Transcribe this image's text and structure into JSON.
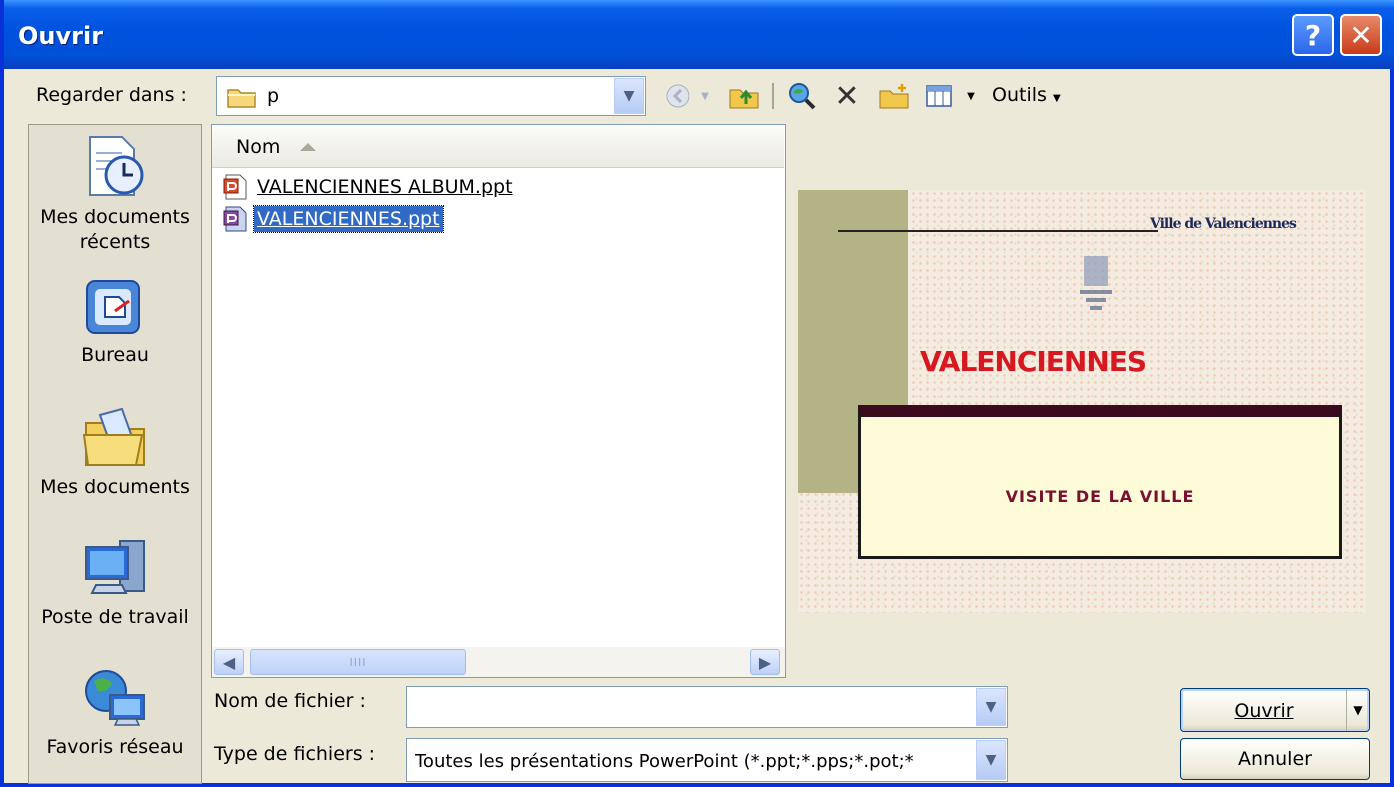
{
  "window": {
    "title": "Ouvrir"
  },
  "titlebar": {
    "help_glyph": "?",
    "close_glyph": "✕"
  },
  "lookin": {
    "label": "Regarder dans :",
    "value": "p"
  },
  "toolbar": {
    "tools_label": "Outils",
    "icons": [
      "back-icon",
      "up-folder-icon",
      "search-web-icon",
      "delete-icon",
      "new-folder-icon",
      "views-icon"
    ]
  },
  "places": [
    {
      "label": "Mes documents récents",
      "icon": "recent-documents-icon"
    },
    {
      "label": "Bureau",
      "icon": "desktop-icon"
    },
    {
      "label": "Mes documents",
      "icon": "my-documents-icon"
    },
    {
      "label": "Poste de travail",
      "icon": "my-computer-icon"
    },
    {
      "label": "Favoris réseau",
      "icon": "network-places-icon"
    }
  ],
  "filelist": {
    "column_header": "Nom",
    "files": [
      {
        "name": "VALENCIENNES ALBUM.ppt",
        "selected": false
      },
      {
        "name": "VALENCIENNES.ppt",
        "selected": true
      }
    ],
    "scroll_thumb_grip": "IIII"
  },
  "preview": {
    "logo_text": "Ville de Valenciennes",
    "title": "VALENCIENNES",
    "subtitle": "VISITE DE LA VILLE"
  },
  "form": {
    "filename_label": "Nom de fichier :",
    "filename_value": "",
    "filetype_label": "Type de fichiers :",
    "filetype_value": "Toutes les présentations PowerPoint (*.ppt;*.pps;*.pot;*"
  },
  "buttons": {
    "open": "Ouvrir",
    "cancel": "Annuler"
  },
  "colors": {
    "titlebar": "#0053e0",
    "selection": "#316ac5",
    "dialog_bg": "#ece9d8"
  }
}
